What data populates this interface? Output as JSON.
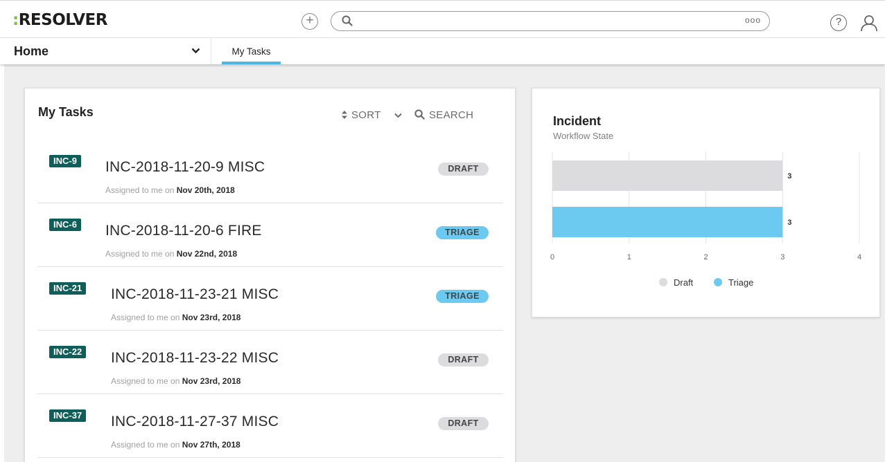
{
  "app": {
    "logo_prefix": ":",
    "logo_text": "RESOLVER",
    "add_icon": "plus-circle-icon",
    "search": {
      "placeholder": "",
      "value": "",
      "more_label": "ooo"
    },
    "help_label": "?"
  },
  "nav": {
    "home_label": "Home",
    "tabs": [
      {
        "label": "My Tasks",
        "active": true
      }
    ]
  },
  "tasks": {
    "title": "My Tasks",
    "sort_label": "SORT",
    "search_label": "SEARCH",
    "assigned_prefix": "Assigned to me on",
    "items": [
      {
        "id": "INC-9",
        "title": "INC-2018-11-20-9 MISC",
        "date": "Nov 20th, 2018",
        "state": "DRAFT"
      },
      {
        "id": "INC-6",
        "title": "INC-2018-11-20-6 FIRE",
        "date": "Nov 22nd, 2018",
        "state": "TRIAGE"
      },
      {
        "id": "INC-21",
        "title": "INC-2018-11-23-21 MISC",
        "date": "Nov 23rd, 2018",
        "state": "TRIAGE"
      },
      {
        "id": "INC-22",
        "title": "INC-2018-11-23-22 MISC",
        "date": "Nov 23rd, 2018",
        "state": "DRAFT"
      },
      {
        "id": "INC-37",
        "title": "INC-2018-11-27-37 MISC",
        "date": "Nov 27th, 2018",
        "state": "DRAFT"
      }
    ]
  },
  "chart": {
    "title": "Incident",
    "subtitle": "Workflow State"
  },
  "chart_data": {
    "type": "bar",
    "orientation": "horizontal",
    "title": "Incident",
    "subtitle": "Workflow State",
    "categories": [
      "Draft",
      "Triage"
    ],
    "values": [
      3,
      3
    ],
    "colors": [
      "#dcdcde",
      "#6ccaf0"
    ],
    "xlim": [
      0,
      4
    ],
    "xticks": [
      "0",
      "1",
      "2",
      "3",
      "4"
    ],
    "grid": true,
    "legend": "bottom",
    "data_labels": [
      "3",
      "3"
    ]
  },
  "colors": {
    "accent": "#4db8e6",
    "badge": "#0e5f5a",
    "logo_dot": "#7ac143",
    "draft": "#dcdcde",
    "triage": "#6ccaf0"
  }
}
